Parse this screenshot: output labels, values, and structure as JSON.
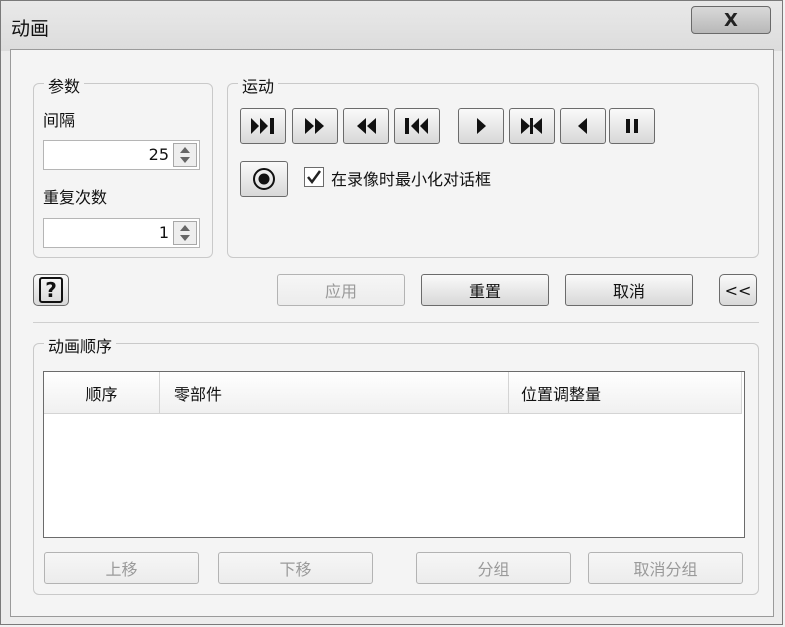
{
  "window": {
    "title": "动画",
    "close_label": "X"
  },
  "params": {
    "legend": "参数",
    "interval_label": "间隔",
    "interval_value": "25",
    "repeat_label": "重复次数",
    "repeat_value": "1"
  },
  "motion": {
    "legend": "运动",
    "buttons": [
      "play-to-end",
      "fast-forward",
      "fast-rewind",
      "rewind-to-start",
      "play-forward",
      "play-reverse-step",
      "play-reverse",
      "pause"
    ],
    "minimize_checked": true,
    "minimize_label": "在录像时最小化对话框"
  },
  "actions": {
    "help_label": "?",
    "apply": "应用",
    "reset": "重置",
    "cancel": "取消",
    "collapse": "<<"
  },
  "sequence": {
    "legend": "动画顺序",
    "columns": [
      "顺序",
      "零部件",
      "位置调整量"
    ],
    "move_up": "上移",
    "move_down": "下移",
    "group": "分组",
    "ungroup": "取消分组"
  }
}
